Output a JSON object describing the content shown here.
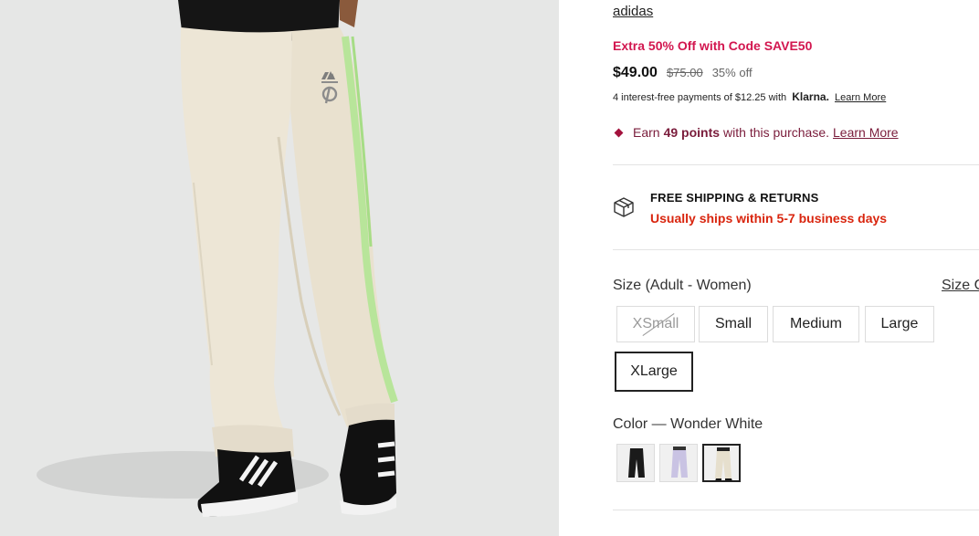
{
  "product_image": {
    "icon": "product-photo-pants"
  },
  "product": {
    "brand": "adidas",
    "promo": "Extra 50% Off with Code SAVE50",
    "price": "$49.00",
    "original_price": "$75.00",
    "discount": "35% off",
    "klarna": {
      "text": "4 interest-free payments of $12.25 with",
      "logo": "Klarna.",
      "link": "Learn More"
    },
    "points": {
      "prefix": "Earn",
      "amount": "49 points",
      "suffix": "with this purchase.",
      "link": "Learn More"
    }
  },
  "shipping": {
    "title": "FREE SHIPPING & RETURNS",
    "subtitle": "Usually ships within 5-7 business days",
    "icon": "box-icon"
  },
  "size": {
    "label": "Size (Adult - Women)",
    "guide": "Size G",
    "options": [
      {
        "label": "XSmall",
        "state": "unavailable"
      },
      {
        "label": "Small",
        "state": "available"
      },
      {
        "label": "Medium",
        "state": "available"
      },
      {
        "label": "Large",
        "state": "available"
      },
      {
        "label": "XLarge",
        "state": "selected"
      }
    ]
  },
  "color": {
    "label": "Color — Wonder White",
    "swatches": [
      {
        "name": "black",
        "selected": false
      },
      {
        "name": "lavender",
        "selected": false
      },
      {
        "name": "wonder-white",
        "selected": true
      }
    ]
  },
  "colors": {
    "promo": "#d2164f",
    "points": "#7a1c3b",
    "shipping_sub": "#d9250e",
    "image_bg": "#e6e7e6"
  }
}
